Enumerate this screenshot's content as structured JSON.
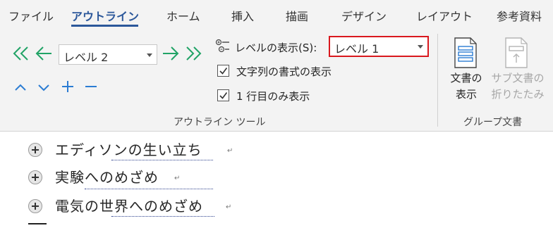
{
  "tabs": [
    "ファイル",
    "アウトライン",
    "ホーム",
    "挿入",
    "描画",
    "デザイン",
    "レイアウト",
    "参考資料"
  ],
  "level_combo": {
    "value": "レベル 2"
  },
  "show_level": {
    "label": "レベルの表示(S):",
    "value": "レベル 1",
    "highlight_color": "#d9181e"
  },
  "options": {
    "show_formatting": {
      "label": "文字列の書式の表示",
      "checked": true
    },
    "first_line_only": {
      "label": "1 行目のみ表示",
      "checked": true
    }
  },
  "groups": {
    "outline_tools": "アウトライン ツール",
    "master_document": "グループ文書"
  },
  "master_buttons": {
    "show_document": [
      "文書の",
      "表示"
    ],
    "collapse_subdocuments": [
      "サブ文書の",
      "折りたたみ"
    ]
  },
  "document": {
    "items": [
      {
        "text": "エディソンの生い立ち",
        "paragraph_mark": "↵"
      },
      {
        "text": "実験へのめざめ",
        "paragraph_mark": "↵"
      },
      {
        "text": "電気の世界へのめざめ",
        "paragraph_mark": "↵"
      }
    ]
  },
  "colors": {
    "accent": "#2b579a",
    "arrow_green": "#21a366",
    "arrow_blue": "#2b7cd3"
  },
  "icons": [
    "promote-to-heading-icon",
    "promote-icon",
    "demote-icon",
    "demote-to-body-icon",
    "move-up-icon",
    "move-down-icon",
    "expand-icon",
    "collapse-icon"
  ]
}
